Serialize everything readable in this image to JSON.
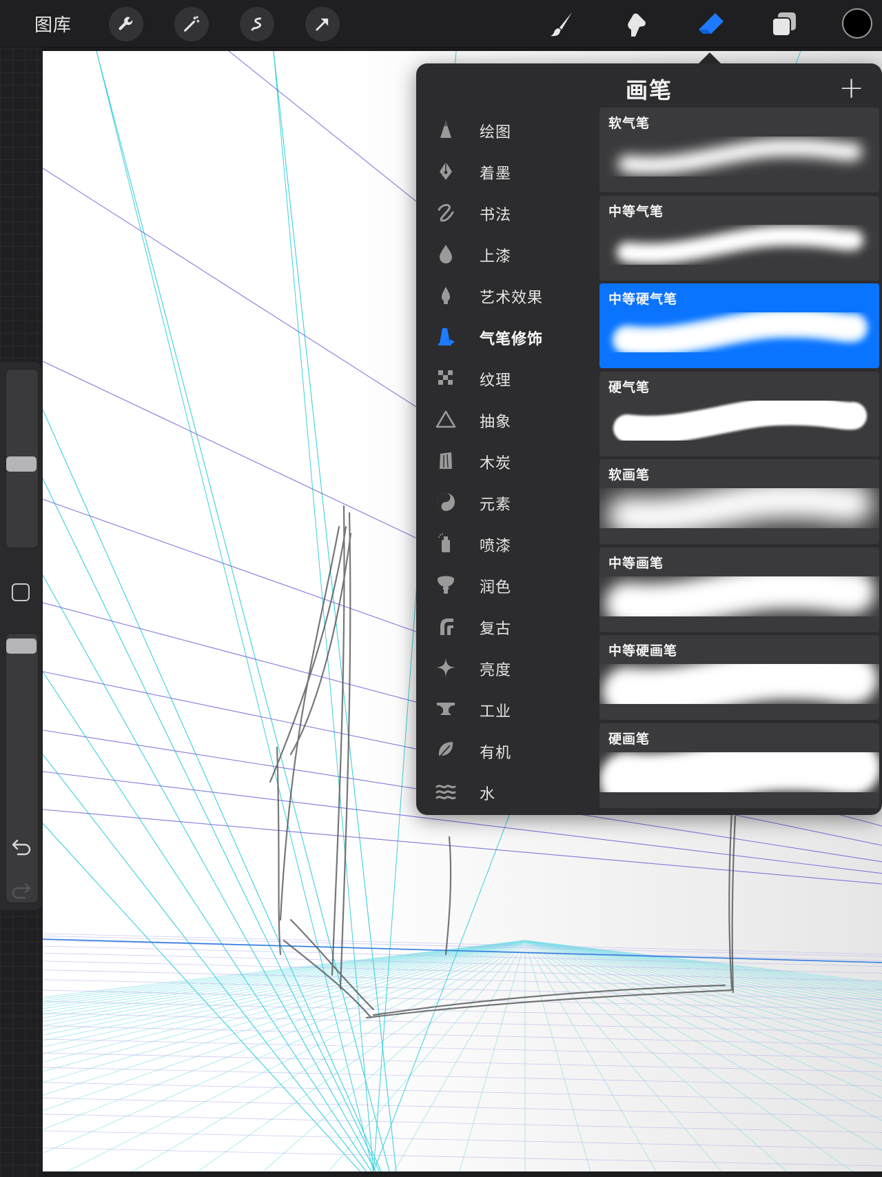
{
  "topbar": {
    "gallery_label": "图库",
    "tools_left": [
      "wrench-icon",
      "magic-wand-icon",
      "selection-icon",
      "transform-arrow-icon"
    ],
    "tools_right": [
      "paintbrush-icon",
      "smudge-icon",
      "eraser-icon",
      "layers-icon"
    ],
    "active_color": "#000000"
  },
  "brush_panel": {
    "title": "画笔",
    "add_label": "+",
    "categories": [
      {
        "label": "绘图",
        "icon": "pencil-tip-icon"
      },
      {
        "label": "着墨",
        "icon": "ink-nib-icon"
      },
      {
        "label": "书法",
        "icon": "calligraphy-icon"
      },
      {
        "label": "上漆",
        "icon": "paint-drop-icon"
      },
      {
        "label": "艺术效果",
        "icon": "artistic-icon"
      },
      {
        "label": "气笔修饰",
        "icon": "airbrush-icon"
      },
      {
        "label": "纹理",
        "icon": "texture-icon"
      },
      {
        "label": "抽象",
        "icon": "abstract-triangle-icon"
      },
      {
        "label": "木炭",
        "icon": "charcoal-icon"
      },
      {
        "label": "元素",
        "icon": "yin-yang-icon"
      },
      {
        "label": "喷漆",
        "icon": "spray-can-icon"
      },
      {
        "label": "润色",
        "icon": "touchup-brush-icon"
      },
      {
        "label": "复古",
        "icon": "retro-icon"
      },
      {
        "label": "亮度",
        "icon": "sparkle-icon"
      },
      {
        "label": "工业",
        "icon": "anvil-icon"
      },
      {
        "label": "有机",
        "icon": "leaf-icon"
      },
      {
        "label": "水",
        "icon": "water-waves-icon"
      }
    ],
    "active_category": "气笔修饰",
    "brushes": [
      {
        "name": "软气笔",
        "style": "soft-thin"
      },
      {
        "name": "中等气笔",
        "style": "medium-thin"
      },
      {
        "name": "中等硬气笔",
        "style": "medium-hard-thin"
      },
      {
        "name": "硬气笔",
        "style": "hard-thin"
      },
      {
        "name": "软画笔",
        "style": "soft-thick"
      },
      {
        "name": "中等画笔",
        "style": "medium-thick"
      },
      {
        "name": "中等硬画笔",
        "style": "medium-hard-thick"
      },
      {
        "name": "硬画笔",
        "style": "hard-thick"
      }
    ],
    "selected_brush": "中等硬气笔",
    "accent_color": "#0a74ff"
  },
  "sidebar": {
    "brush_size_level": 0.55,
    "opacity_level": 0.1
  }
}
